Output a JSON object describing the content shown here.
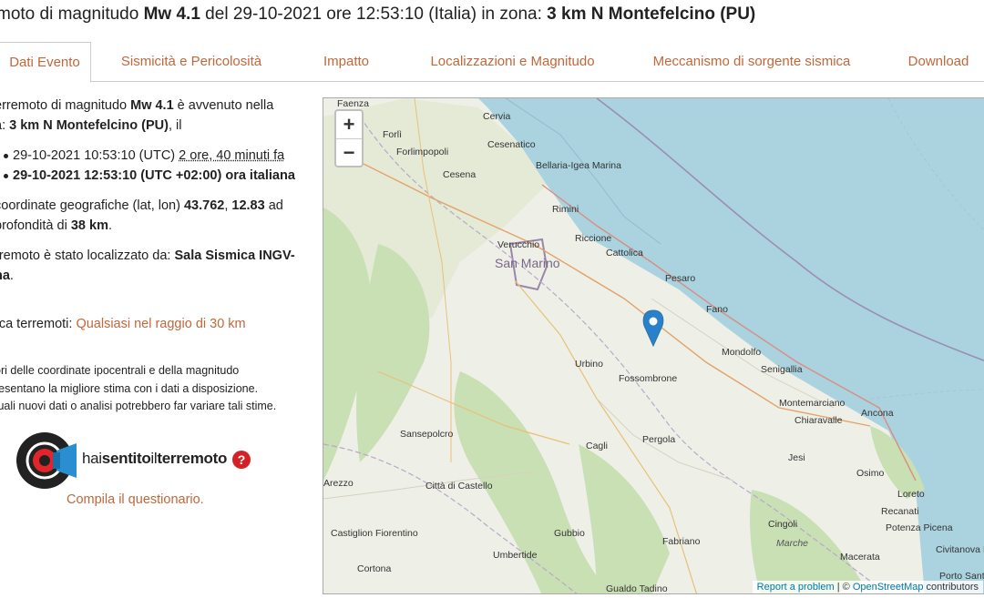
{
  "header": {
    "title_prefix": "moto di magnitudo ",
    "magnitude": "Mw 4.1",
    "title_mid": " del 29-10-2021 ore 12:53:10 (Italia) in zona: ",
    "zone": "3 km N Montefelcino (PU)"
  },
  "tabs": [
    {
      "label": "Dati Evento",
      "active": true
    },
    {
      "label": "Sismicità e Pericolosità",
      "active": false
    },
    {
      "label": "Impatto",
      "active": false
    },
    {
      "label": "Localizzazioni e Magnitudo",
      "active": false
    },
    {
      "label": "Meccanismo di sorgente sismica",
      "active": false
    },
    {
      "label": "Download",
      "active": false
    }
  ],
  "details": {
    "line1_pre": "erremoto di magnitudo ",
    "line1_mag": "Mw 4.1",
    "line1_post": " è avvenuto nella",
    "line2_pre": "a: ",
    "line2_zone": "3 km N Montefelcino (PU)",
    "line2_post": ", il",
    "utc_time": "29-10-2021 10:53:10 (UTC) ",
    "ago": "2 ore, 40 minuti fa",
    "local_time": "29-10-2021 12:53:10 (UTC +02:00) ora italiana",
    "coord_pre": "coordinate geografiche (lat, lon) ",
    "lat": "43.762",
    "lon": "12.83",
    "coord_post": " ad",
    "depth_pre": "profondità di ",
    "depth": "38 km",
    "depth_post": ".",
    "loc_pre": "rremoto è stato localizzato da: ",
    "loc_by": "Sala Sismica INGV-",
    "loc_by2": "na",
    "loc_post": ".",
    "search_pre": "rca terremoti: ",
    "search_link": "Qualsiasi nel raggio di 30 km"
  },
  "note": {
    "line1": "ori delle coordinate ipocentrali e della magnitudo",
    "line2": "resentano la migliore stima con i dati a disposizione.",
    "line3": "tuali nuovi dati o analisi potrebbero far variare tali stime."
  },
  "hst": {
    "text_light": "hai",
    "text_bold1": "sentito",
    "text_light2": "il",
    "text_bold2": "terremoto",
    "question": "?",
    "link": "Compila il questionario."
  },
  "map": {
    "zoom_in": "+",
    "zoom_out": "−",
    "attribution_link1": "Report a problem",
    "attribution_sep": " | © ",
    "attribution_link2": "OpenStreetMap",
    "attribution_tail": " contributors",
    "places": [
      "Faenza",
      "Forlì",
      "Forlimpopoli",
      "Cervia",
      "Cesenatico",
      "Bellaria-Igea Marina",
      "Cesena",
      "Rimini",
      "Riccione",
      "Verucchio",
      "Cattolica",
      "San Marino",
      "Pesaro",
      "Fano",
      "Mondolfo",
      "Senigallia",
      "Urbino",
      "Fossombrone",
      "Montemarciano",
      "Chiaravalle",
      "Ancona",
      "Sansepolcro",
      "Cagli",
      "Pergola",
      "Arezzo",
      "Città di Castello",
      "Jesi",
      "Osimo",
      "Loreto",
      "Recanati",
      "Castiglion Fiorentino",
      "Gubbio",
      "Fabriano",
      "Cingoli",
      "Potenza Picena",
      "Marche",
      "Umbertide",
      "Macerata",
      "Civitanova Marche",
      "Cortona",
      "Gualdo Tadino",
      "Porto Sant'Elp"
    ]
  },
  "colors": {
    "accent": "#c0673b",
    "sea": "#aad3df",
    "land": "#eef0e8",
    "marker": "#2a81cb"
  }
}
